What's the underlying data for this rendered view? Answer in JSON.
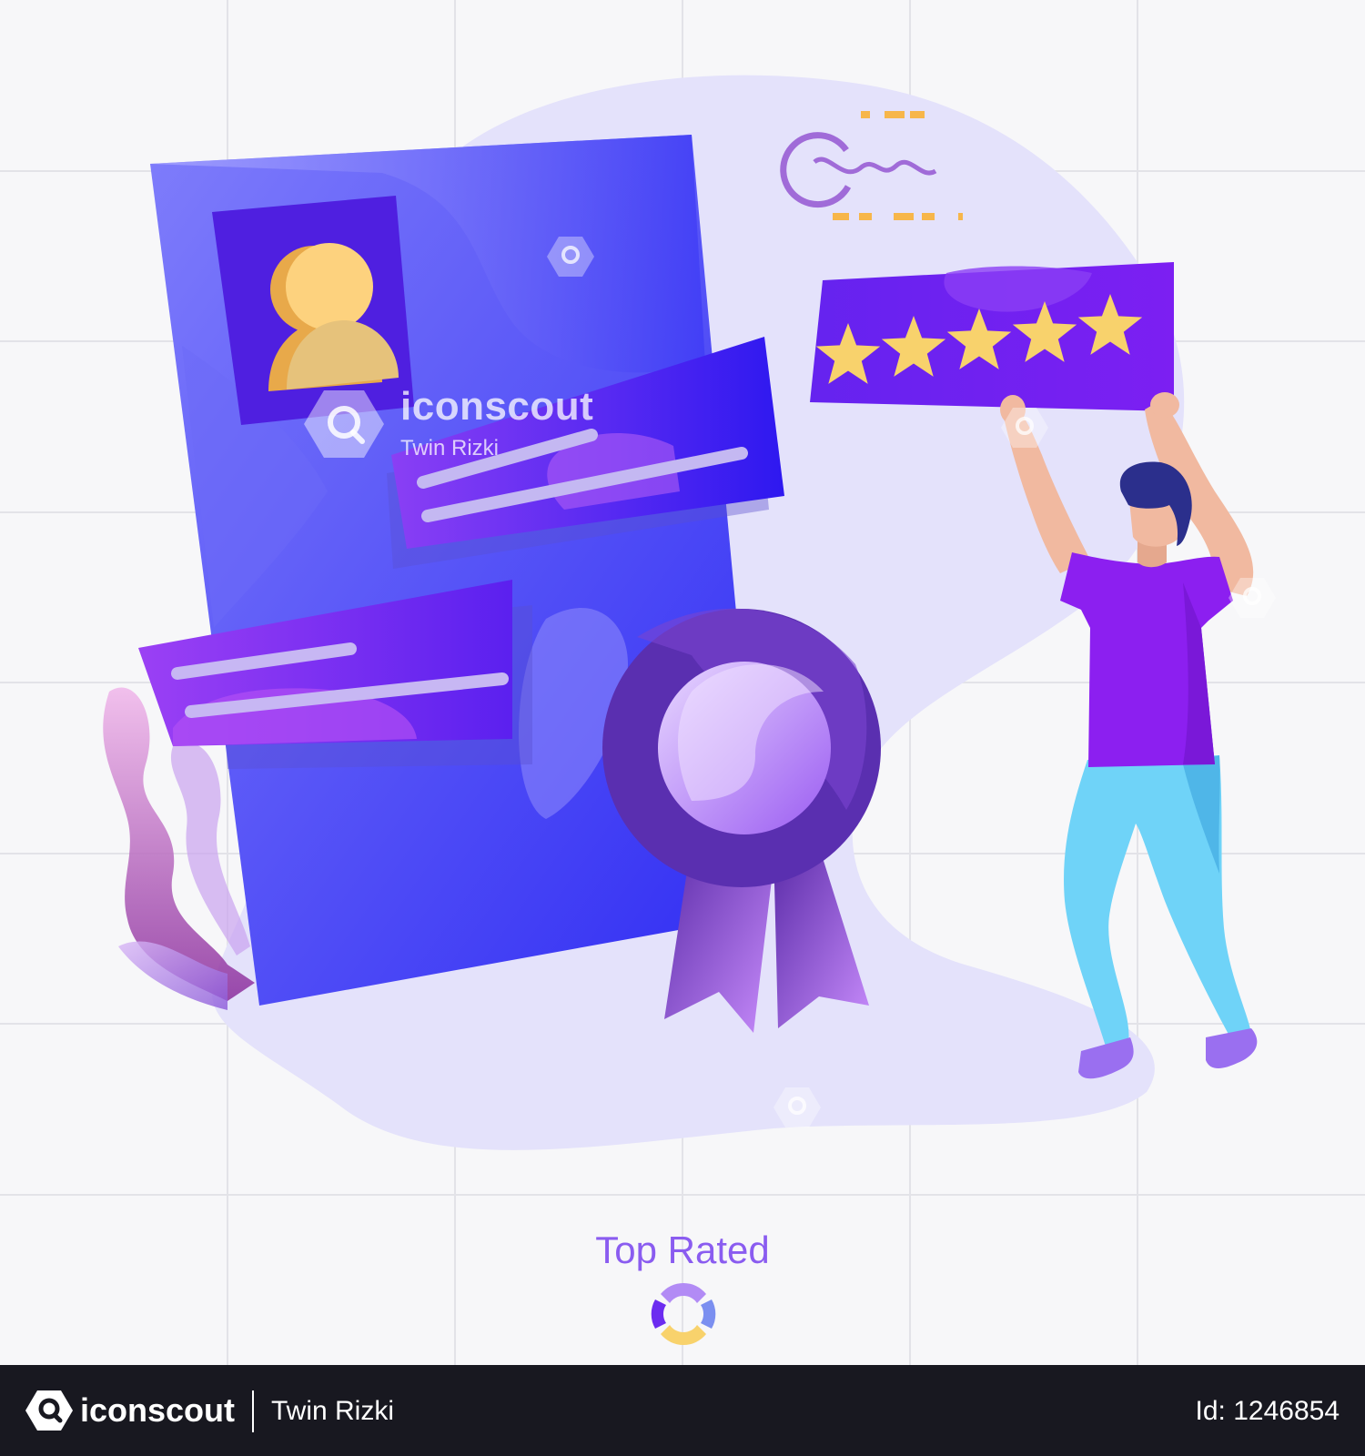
{
  "watermark": {
    "brand": "iconscout",
    "author": "Twin Rizki"
  },
  "illustration": {
    "rating_stars": 5,
    "colors": {
      "background": "#f7f7f9",
      "blob": "#e4e2fb",
      "document": "#4f4bf5",
      "card": "#6b22f0",
      "star": "#f8d26c",
      "badge": "#5a2fb0",
      "person_shirt": "#8c1ff0",
      "person_pants": "#6fd3f8",
      "person_skin": "#f1b9a0",
      "person_hair": "#2b2f8c",
      "accent_orange": "#f7b64a"
    }
  },
  "caption": {
    "title": "Top Rated"
  },
  "footer": {
    "brand": "iconscout",
    "author": "Twin Rizki",
    "id_text": "Id: 1246854"
  }
}
